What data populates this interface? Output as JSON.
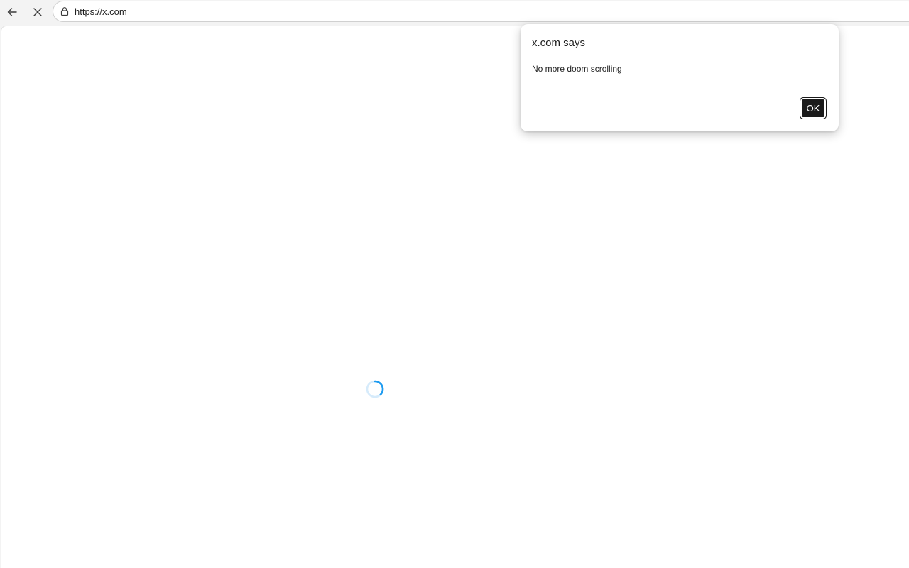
{
  "browser": {
    "url": "https://x.com",
    "back_icon": "arrow-left-icon",
    "stop_icon": "close-icon",
    "lock_icon": "lock-icon"
  },
  "page": {
    "loading_icon": "spinner-icon",
    "spinner_color": "#1d9bf0"
  },
  "dialog": {
    "title": "x.com says",
    "message": "No more doom scrolling",
    "ok_label": "OK"
  }
}
